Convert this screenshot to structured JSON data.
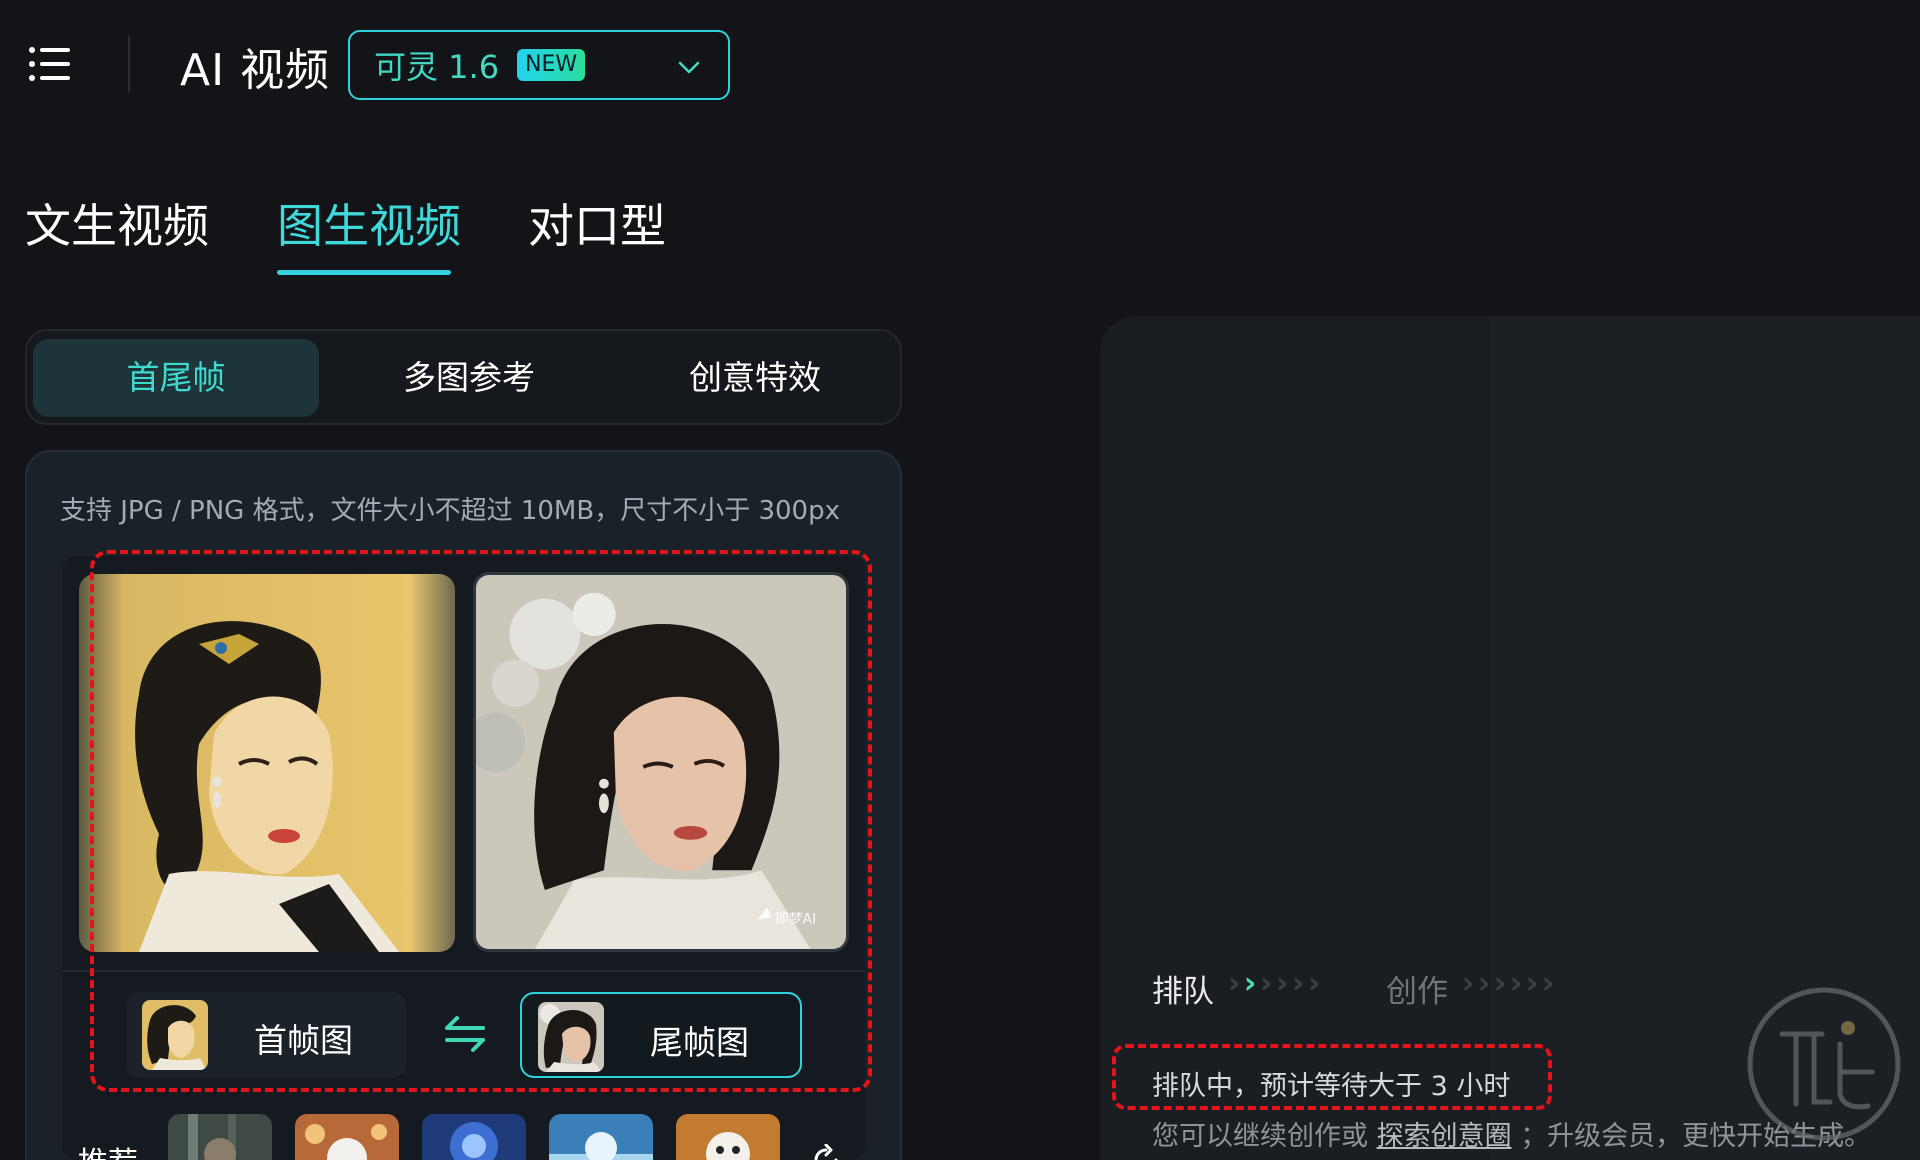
{
  "header": {
    "title": "AI 视频",
    "model": {
      "name": "可灵 1.6",
      "badge": "NEW"
    },
    "accent_color": "#2fd1dc"
  },
  "main_tabs": [
    {
      "label": "文生视频",
      "active": false
    },
    {
      "label": "图生视频",
      "active": true
    },
    {
      "label": "对口型",
      "active": false
    }
  ],
  "sub_tabs": [
    {
      "label": "首尾帧",
      "active": true
    },
    {
      "label": "多图参考",
      "active": false
    },
    {
      "label": "创意特效",
      "active": false
    }
  ],
  "upload": {
    "hint": "支持 JPG / PNG 格式，文件大小不超过 10MB，尺寸不小于 300px",
    "start_frame_label": "首帧图",
    "end_frame_label": "尾帧图",
    "selected_frame": "end",
    "image_watermark": "即梦AI"
  },
  "recommendations": {
    "label": "推荐",
    "thumbnail_count": 5
  },
  "preview": {
    "stage_queue": "排队",
    "stage_create": "创作",
    "status": "排队中，预计等待大于 3 小时",
    "hint_prefix": "您可以继续创作或",
    "hint_link": "探索创意圈",
    "hint_suffix": "；升级会员，更快开始生成。"
  },
  "colors": {
    "active_tab": "#3fd9dc",
    "progress_active": "#46e6b6",
    "highlight_box": "#e4141b"
  }
}
